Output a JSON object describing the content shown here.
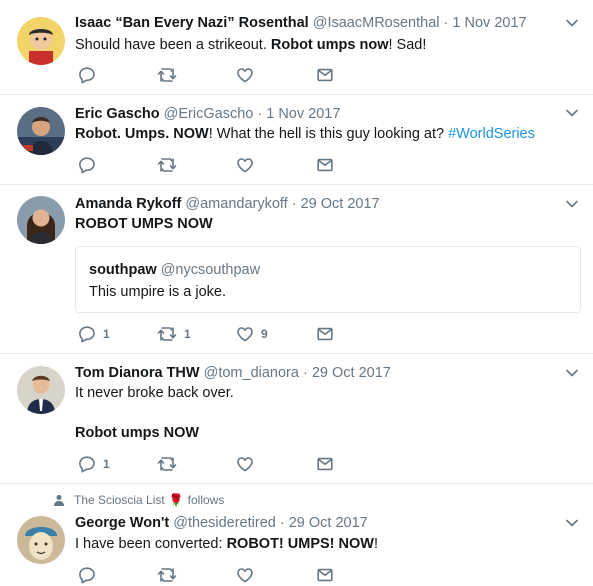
{
  "tweets": [
    {
      "name": "Isaac “Ban Every Nazi” Rosenthal",
      "handle": "@IsaacMRosenthal",
      "date": "1 Nov 2017",
      "text": [
        {
          "t": "Should have been a strikeout. ",
          "s": "plain"
        },
        {
          "t": "Robot umps now",
          "s": "bold"
        },
        {
          "t": "! Sad!",
          "s": "plain"
        }
      ],
      "reply_count": "",
      "retweet_count": "",
      "like_count": ""
    },
    {
      "name": "Eric Gascho",
      "handle": "@EricGascho",
      "date": "1 Nov 2017",
      "text": [
        {
          "t": "Robot. Umps. NOW",
          "s": "bold"
        },
        {
          "t": "! What the hell is this guy looking at? ",
          "s": "plain"
        },
        {
          "t": "#WorldSeries",
          "s": "hashtag"
        }
      ],
      "reply_count": "",
      "retweet_count": "",
      "like_count": ""
    },
    {
      "name": "Amanda Rykoff",
      "handle": "@amandarykoff",
      "date": "29 Oct 2017",
      "text": [
        {
          "t": "ROBOT UMPS NOW",
          "s": "bold"
        }
      ],
      "quote": {
        "name": "southpaw",
        "handle": "@nycsouthpaw",
        "text": "This umpire is a joke."
      },
      "reply_count": "1",
      "retweet_count": "1",
      "like_count": "9"
    },
    {
      "name": "Tom Dianora THW",
      "handle": "@tom_dianora",
      "date": "29 Oct 2017",
      "text": [
        {
          "t": "It never broke back over.",
          "s": "plain"
        }
      ],
      "text2": [
        {
          "t": "Robot umps NOW",
          "s": "bold"
        }
      ],
      "reply_count": "1",
      "retweet_count": "",
      "like_count": ""
    },
    {
      "context": {
        "name": "The Scioscia List",
        "emoji": "🌹",
        "verb": "follows"
      },
      "name": "George Won't",
      "handle": "@thesideretired",
      "date": "29 Oct 2017",
      "text": [
        {
          "t": "I have been converted: ",
          "s": "plain"
        },
        {
          "t": "ROBOT! UMPS! NOW",
          "s": "bold"
        },
        {
          "t": "!",
          "s": "plain"
        }
      ],
      "reply_count": "",
      "retweet_count": "",
      "like_count": ""
    }
  ],
  "dot": "·",
  "icons": {
    "reply": "reply-icon",
    "retweet": "retweet-icon",
    "like": "like-icon",
    "dm": "direct-message-icon",
    "caret": "chevron-down-icon"
  },
  "colors": {
    "icon": "#657786",
    "hashtag": "#1b95e0",
    "text": "#14171a",
    "muted": "#657786",
    "border": "#e6ecf0"
  }
}
